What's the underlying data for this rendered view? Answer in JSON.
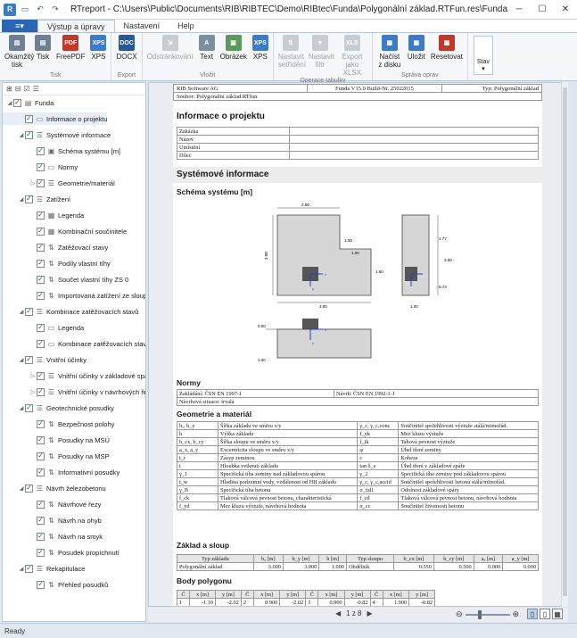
{
  "window": {
    "title": "RTreport - C:\\Users\\Public\\Documents\\RIB\\RIBTEC\\Demo\\RIBtec\\Funda\\Polygonální základ.RTFun.res\\Funda.rtml",
    "minimize": "─",
    "maximize": "☐",
    "close": "✕"
  },
  "ribbon_tabs": {
    "file": "≡▾",
    "tabs": [
      "Výstup a úpravy",
      "Nastavení",
      "Help"
    ]
  },
  "ribbon": {
    "groups": [
      {
        "label": "Tisk",
        "buttons": [
          {
            "label": "Okamžitý tisk",
            "icon": "printer-icon",
            "disabled": false
          },
          {
            "label": "Tisk",
            "icon": "print-icon",
            "disabled": false
          },
          {
            "label": "FreePDF",
            "icon": "pdf-icon",
            "disabled": false
          },
          {
            "label": "XPS",
            "icon": "xps-icon",
            "disabled": false
          }
        ]
      },
      {
        "label": "Export",
        "buttons": [
          {
            "label": "DOCX",
            "icon": "docx-icon",
            "disabled": false
          }
        ]
      },
      {
        "label": "Vložit",
        "buttons": [
          {
            "label": "Odstránkování",
            "icon": "page-break-icon",
            "disabled": true
          },
          {
            "label": "Text",
            "icon": "text-icon",
            "disabled": false
          },
          {
            "label": "Obrázek",
            "icon": "image-icon",
            "disabled": false
          },
          {
            "label": "XPS",
            "icon": "xps-insert-icon",
            "disabled": false
          }
        ]
      },
      {
        "label": "Operace tabulky",
        "buttons": [
          {
            "label": "Nastavit setřídění",
            "icon": "sort-icon",
            "disabled": true
          },
          {
            "label": "Nastavit filtr",
            "icon": "filter-icon",
            "disabled": true
          },
          {
            "label": "Export jako XLSX",
            "icon": "xlsx-icon",
            "disabled": true
          }
        ]
      },
      {
        "label": "Správa oprav",
        "buttons": [
          {
            "label": "Načíst z disku",
            "icon": "load-icon",
            "disabled": false
          },
          {
            "label": "Uložit",
            "icon": "save-icon",
            "disabled": false
          },
          {
            "label": "Resetovat",
            "icon": "reset-icon",
            "disabled": false
          }
        ]
      }
    ],
    "stav": "Stav"
  },
  "tree": [
    {
      "label": "Funda",
      "level": 0,
      "icon": "root",
      "expanded": true
    },
    {
      "label": "Informace o projektu",
      "level": 1,
      "icon": "page"
    },
    {
      "label": "Systémové informace",
      "level": 1,
      "icon": "list",
      "expanded": true
    },
    {
      "label": "Schéma systému [m]",
      "level": 2,
      "icon": "image"
    },
    {
      "label": "Normy",
      "level": 2,
      "icon": "page"
    },
    {
      "label": "Geometrie/materiál",
      "level": 2,
      "icon": "list",
      "collapsed": true
    },
    {
      "label": "Zatížení",
      "level": 1,
      "icon": "list",
      "expanded": true
    },
    {
      "label": "Legenda",
      "level": 2,
      "icon": "table"
    },
    {
      "label": "Kombinační součinitele",
      "level": 2,
      "icon": "table"
    },
    {
      "label": "Zatěžovací stavy",
      "level": 2,
      "icon": "sort"
    },
    {
      "label": "Podíly vlastní tíhy",
      "level": 2,
      "icon": "sort"
    },
    {
      "label": "Součet vlastní tíhy ZS 0",
      "level": 2,
      "icon": "sort"
    },
    {
      "label": "Importovaná zatížení ze sloup",
      "level": 2,
      "icon": "sort"
    },
    {
      "label": "Kombinace zatěžovacích stavů",
      "level": 1,
      "icon": "list",
      "expanded": true
    },
    {
      "label": "Legenda",
      "level": 2,
      "icon": "page"
    },
    {
      "label": "Kombinace zatěžovacích stavů",
      "level": 2,
      "icon": "page"
    },
    {
      "label": "Vnitřní účinky",
      "level": 1,
      "icon": "list",
      "expanded": true
    },
    {
      "label": "Vnitřní účinky v základové spá",
      "level": 2,
      "icon": "list",
      "collapsed": true
    },
    {
      "label": "Vnitřní účinky v návrhových ře",
      "level": 2,
      "icon": "list",
      "collapsed": true
    },
    {
      "label": "Geotechnické posudky",
      "level": 1,
      "icon": "list",
      "expanded": true
    },
    {
      "label": "Bezpečnost polohy",
      "level": 2,
      "icon": "sort"
    },
    {
      "label": "Posudky na MSÚ",
      "level": 2,
      "icon": "sort"
    },
    {
      "label": "Posudky na MSP",
      "level": 2,
      "icon": "sort"
    },
    {
      "label": "Informativní posudky",
      "level": 2,
      "icon": "sort"
    },
    {
      "label": "Návrh železobetonu",
      "level": 1,
      "icon": "list",
      "expanded": true
    },
    {
      "label": "Návrhové řezy",
      "level": 2,
      "icon": "sort"
    },
    {
      "label": "Návrh na ohyb",
      "level": 2,
      "icon": "sort"
    },
    {
      "label": "Návrh na smyk",
      "level": 2,
      "icon": "sort"
    },
    {
      "label": "Posudek propíchnutí",
      "level": 2,
      "icon": "sort"
    },
    {
      "label": "Rekapitulace",
      "level": 1,
      "icon": "list",
      "expanded": true
    },
    {
      "label": "Přehled posudků",
      "level": 2,
      "icon": "sort"
    }
  ],
  "report": {
    "header": {
      "company": "RIB Software AG",
      "version": "Funda V15.0 Build-Nr. 25022015",
      "type": "Typ: Polygonální základ",
      "file": "Soubor: Polygonální základ.RTfun"
    },
    "project_title": "Informace o projektu",
    "project_rows": [
      "Zakázka",
      "Název",
      "Umístění",
      "Dílec"
    ],
    "system_title": "Systémové informace",
    "schema_title": "Schéma systému [m]",
    "drawing_labels": {
      "width_top": "2.00",
      "dim_a": "1.00",
      "dim_b": "1.00",
      "height_left": "3.00",
      "dim_c": "1.60",
      "width_bottom": "3.00",
      "side_top": "1.77",
      "side_mid": "3.00",
      "side_bot": "0.73",
      "side_width": "1.00",
      "elev_top": "0.00",
      "elev_bottom": "1.00",
      "axis_x": "x",
      "axis_y": "y",
      "axis_z": "z"
    },
    "norms_title": "Normy",
    "norms": {
      "left": "Zakládání: ČSN EN 1997-1",
      "right": "Návrh: ČSN EN 1992-1-1",
      "situation": "Návrhová situace: trvalá"
    },
    "geometry_title": "Geometrie a materiál",
    "geometry_rows": [
      [
        "bₓ, b_y",
        "Šířka základu ve směru x/y",
        "γ_c, γ_c,conc",
        "Součinitel spolehlivosti výztuže stálá/mimořád."
      ],
      [
        "h",
        "Výška základu",
        "f_yk",
        "Mez kluzu výztuže"
      ],
      [
        "b_cx, b_cy",
        "Šířka sloupu ve směru x/y",
        "f_tk",
        "Tahová pevnost výztuže"
      ],
      [
        "a_x, a_y",
        "Excentricita sloupu ve směru x/y",
        "φ",
        "Úhel tření zeminy"
      ],
      [
        "t_r",
        "Zásyp zeminou",
        "c",
        "Koheze"
      ],
      [
        "t",
        "Hloubka vetknutí základu",
        "tan δ_s",
        "Úhel tření v základové spáře"
      ],
      [
        "γ_1",
        "Specifická tíha zeminy nad základovou spárou",
        "γ_2",
        "Specifická tíha zeminy pod základovou spárou"
      ],
      [
        "t_w",
        "Hladina podzemní vody, vzdálenost od HH základu",
        "γ_c, γ_c,accid",
        "Součinitel spolehlivosti betonu stálá/mimořád."
      ],
      [
        "γ_B",
        "Specifická tíha betonu",
        "σ_fall",
        "Odolnost základové spáry"
      ],
      [
        "f_ck",
        "Tlaková válcová pevnost betonu, charakteristická",
        "f_cd",
        "Tlaková válcová pevnost betonu, návrhová hodnota"
      ],
      [
        "f_yd",
        "Mez kluzu výztuže, návrhová hodnota",
        "α_cc",
        "Součinitel životnosti betonu"
      ]
    ],
    "base_title": "Základ a sloup",
    "base_headers": [
      "Typ základu",
      "bₓ [m]",
      "b_y [m]",
      "h [m]",
      "Typ sloupu",
      "b_cx [m]",
      "b_cy [m]",
      "aₓ [m]",
      "a_y [m]"
    ],
    "base_row": [
      "Polygonální základ",
      "3.000",
      "3.000",
      "1.000",
      "Obdélník",
      "0.550",
      "0.500",
      "0.000",
      "0.000"
    ],
    "poly_title": "Body polygonu",
    "poly_headers": [
      "Č",
      "x [m]",
      "y [m]",
      "Č",
      "x [m]",
      "y [m]",
      "Č",
      "x [m]",
      "y [m]",
      "Č",
      "x [m]",
      "y [m]"
    ],
    "poly_row": [
      "1",
      "-1.10",
      "-2.02",
      "2",
      "0.900",
      "-2.02",
      "3",
      "0.900",
      "-0.82",
      "4",
      "1.900",
      "-0.82"
    ]
  },
  "pager": {
    "first": "◀",
    "text": "1 z 8",
    "next": "▶"
  },
  "zoom": {
    "minus": "⊖",
    "plus": "⊕"
  },
  "status": "Ready"
}
